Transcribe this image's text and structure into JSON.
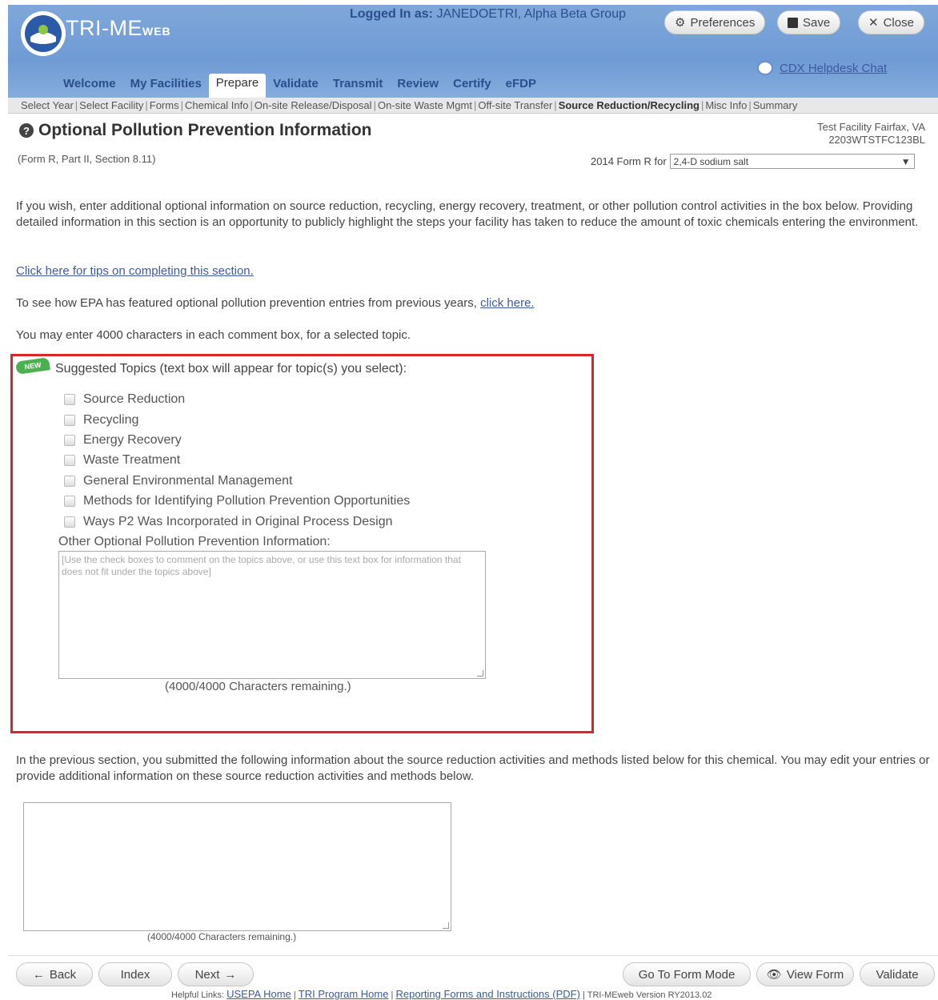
{
  "app": {
    "brand": "TRI-ME",
    "brand_suffix": "WEB"
  },
  "header": {
    "logged_label": "Logged In as:",
    "logged_user": "JANEDOETRI, Alpha Beta Group",
    "preferences_label": "Preferences",
    "save_label": "Save",
    "close_label": "Close",
    "helpdesk_label": "CDX Helpdesk Chat"
  },
  "tabs": [
    {
      "label": "Welcome"
    },
    {
      "label": "My Facilities"
    },
    {
      "label": "Prepare"
    },
    {
      "label": "Validate"
    },
    {
      "label": "Transmit"
    },
    {
      "label": "Review"
    },
    {
      "label": "Certify"
    },
    {
      "label": "eFDP"
    }
  ],
  "subnav": [
    "Select Year",
    "Select Facility",
    "Forms",
    "Chemical Info",
    "On-site Release/Disposal",
    "On-site Waste Mgmt",
    "Off-site Transfer",
    "Source Reduction/Recycling",
    "Misc Info",
    "Summary"
  ],
  "page": {
    "title": "Optional Pollution Prevention Information",
    "subtitle": "(Form R, Part II, Section 8.11)",
    "facility_line1": "Test Facility Fairfax, VA",
    "facility_line2": "2203WTSTFC123BL",
    "form_label": "2014 Form R for",
    "chemical": "2,4-D sodium salt"
  },
  "intro": {
    "p1": "If you wish, enter additional optional information on source reduction, recycling, energy recovery, treatment, or other pollution control activities in the box below. Providing detailed information in this section is an opportunity to publicly highlight the steps your facility has taken to reduce the amount of toxic chemicals entering the environment.",
    "tips_link": "Click here for tips on completing this section.",
    "p2": "To see how EPA has featured optional pollution prevention entries from previous years,",
    "p2_link": "click here.",
    "p3": "You may enter 4000 characters in each comment box, for a selected topic."
  },
  "topics": {
    "badge": "NEW",
    "heading": "Suggested Topics (text box will appear for topic(s) you select):",
    "items": [
      "Source Reduction",
      "Recycling",
      "Energy Recovery",
      "Waste Treatment",
      "General Environmental Management",
      "Methods for Identifying Pollution Prevention Opportunities",
      "Ways P2 Was Incorporated in Original Process Design"
    ],
    "other_label": "Other Optional Pollution Prevention Information:",
    "other_placeholder": "[Use the check boxes to comment on the topics above, or use this text box for information that does not fit under the topics above]",
    "remaining": "(4000/4000 Characters remaining.)"
  },
  "previous": {
    "text": "In the previous section, you submitted the following information about the source reduction activities and methods listed below for this chemical. You may edit your entries or provide additional information on these source reduction activities and methods below.",
    "remaining": "(4000/4000 Characters remaining.)"
  },
  "footer": {
    "back": "Back",
    "index": "Index",
    "next": "Next",
    "form_mode": "Go To Form Mode",
    "view_form": "View Form",
    "validate": "Validate",
    "helpful_label": "Helpful Links:",
    "links": [
      "USEPA Home",
      "TRI Program Home",
      "Reporting Forms and Instructions (PDF)"
    ],
    "version": "TRI-MEweb Version RY2013.02"
  }
}
